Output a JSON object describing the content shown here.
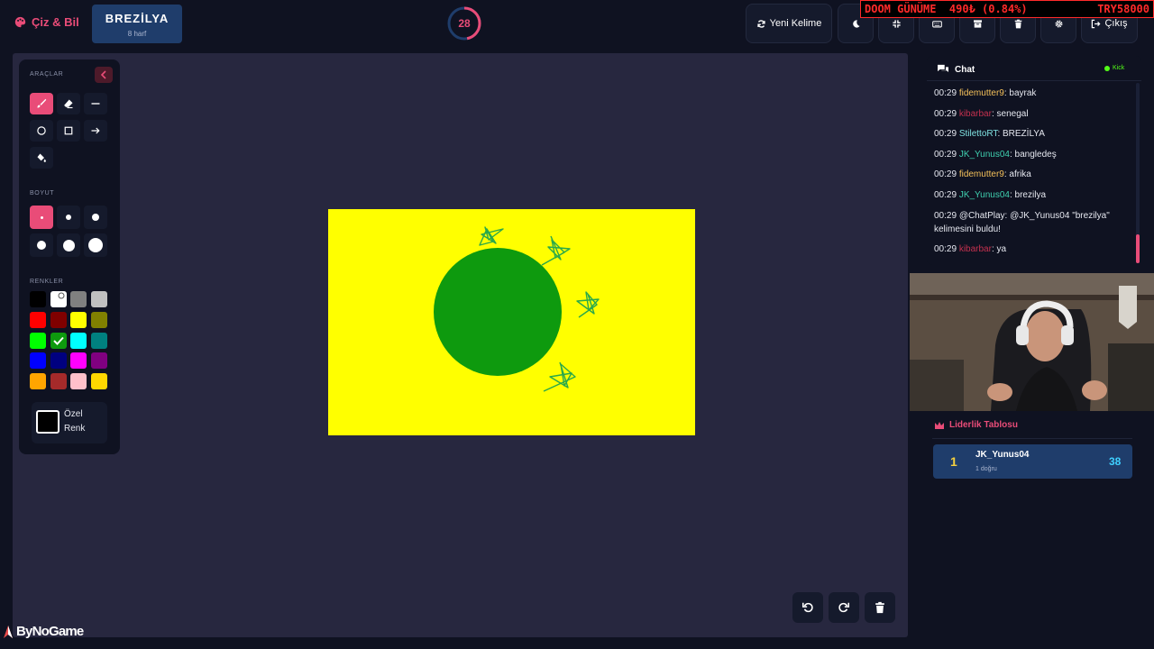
{
  "header": {
    "brand": "Çiz & Bil",
    "word": "BREZİLYA",
    "word_length": "8 harf",
    "timer": 28,
    "timer_progress": 0.47,
    "new_word_label": "Yeni Kelime",
    "logout_label": "Çıkış",
    "icons": [
      "moon-icon",
      "fullscreen-icon",
      "keyboard-icon",
      "archive-icon",
      "trash-icon",
      "gear-icon"
    ]
  },
  "ticker": {
    "left": "DOOM GÜNÜME  490₺ (0.84%)",
    "right": "TRY58000"
  },
  "tools": {
    "section_tools": "ARAÇLAR",
    "section_size": "BOYUT",
    "section_colors": "RENKLER",
    "custom_color_label": "Özel Renk",
    "active_tool": "brush",
    "selected_color": "#0e9a0e",
    "colors": [
      "#000000",
      "#ffffff",
      "#808080",
      "#c0c0c0",
      "#ff0000",
      "#800000",
      "#ffff00",
      "#808000",
      "#00ff00",
      "#0e9a0e",
      "#00ffff",
      "#008080",
      "#0000ff",
      "#000080",
      "#ff00ff",
      "#800080",
      "#ffa500",
      "#a52a2a",
      "#ffc0cb",
      "#ffd700"
    ]
  },
  "drawing": {
    "background": "#ffff00",
    "circle_color": "#0e9a0e",
    "star_color": "#2aa84a"
  },
  "chat": {
    "title": "Chat",
    "platform": "Kick",
    "messages": [
      {
        "time": "00:29",
        "user": "fidemutter9",
        "user_color": "#f4c05a",
        "text": ": bayrak"
      },
      {
        "time": "00:29",
        "user": "kibarbar",
        "user_color": "#c5314f",
        "text": ": senegal"
      },
      {
        "time": "00:29",
        "user": "StilettoRT",
        "user_color": "#7fe0e0",
        "text": ": BREZİLYA"
      },
      {
        "time": "00:29",
        "user": "JK_Yunus04",
        "user_color": "#3fd0b0",
        "text": ": bangledeş"
      },
      {
        "time": "00:29",
        "user": "fidemutter9",
        "user_color": "#f4c05a",
        "text": ": afrika"
      },
      {
        "time": "00:29",
        "user": "JK_Yunus04",
        "user_color": "#3fd0b0",
        "text": ": brezilya"
      },
      {
        "time": "00:29",
        "user": "@ChatPlay",
        "user_color": "#e6e8f0",
        "text": ": @JK_Yunus04 \"brezilya\" kelimesini buldu!"
      },
      {
        "time": "00:29",
        "user": "kibarbar",
        "user_color": "#c5314f",
        "text": ": ya"
      }
    ]
  },
  "leaderboard": {
    "title": "Liderlik Tablosu",
    "players": [
      {
        "rank": "1",
        "name": "JK_Yunus04",
        "correct": "1 doğru",
        "score": "38"
      }
    ]
  },
  "watermark": "ByNoGame"
}
